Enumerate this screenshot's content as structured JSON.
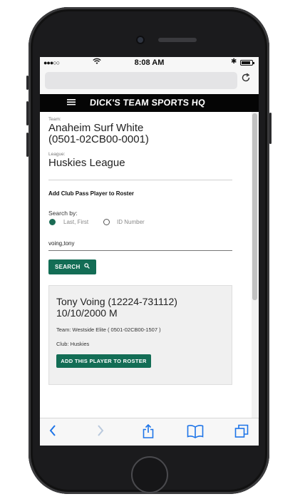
{
  "status_bar": {
    "signal": "●●●○○",
    "time": "8:08 AM",
    "bluetooth": "✱",
    "battery_level": 0.75
  },
  "browser": {
    "reload_icon": "reload-icon"
  },
  "site": {
    "brand": "DICK'S TEAM SPORTS HQ"
  },
  "team": {
    "label": "Team:",
    "name_line1": "Anaheim Surf White",
    "name_line2": "(0501-02CB00-0001)"
  },
  "league": {
    "label": "League:",
    "name": "Huskies League"
  },
  "form": {
    "title": "Add Club Pass Player to Roster",
    "search_by_label": "Search by:",
    "options": [
      {
        "label": "Last, First",
        "selected": true
      },
      {
        "label": "ID Number",
        "selected": false
      }
    ],
    "query": "voing,tony",
    "search_button": "SEARCH"
  },
  "result": {
    "name_line1": "Tony Voing (12224-731112)",
    "name_line2": "10/10/2000 M",
    "team": "Team: Westside Elite ( 0501-02CB00-1507 )",
    "club": "Club: Huskies",
    "add_button": "ADD THIS PLAYER TO ROSTER"
  },
  "colors": {
    "accent": "#136d55",
    "header": "#050505",
    "ios_blue": "#1d74e8"
  }
}
